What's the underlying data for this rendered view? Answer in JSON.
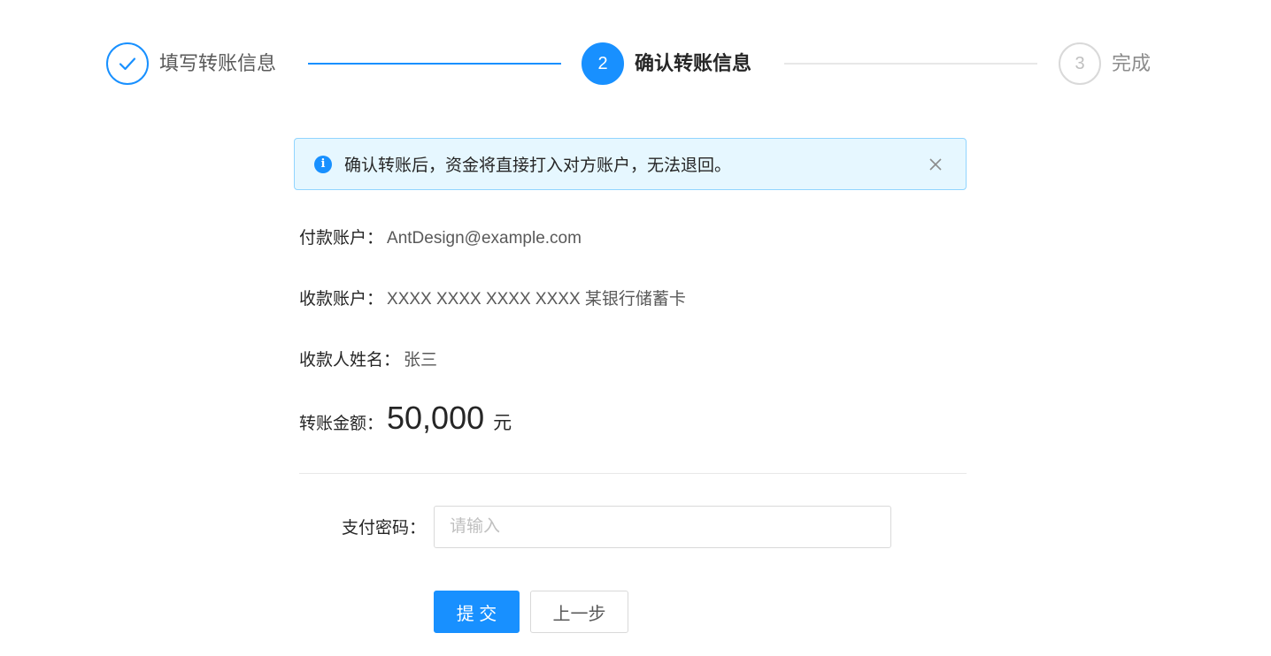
{
  "steps": [
    {
      "label": "填写转账信息",
      "number": ""
    },
    {
      "label": "确认转账信息",
      "number": "2"
    },
    {
      "label": "完成",
      "number": "3"
    }
  ],
  "alert": {
    "message": "确认转账后，资金将直接打入对方账户，无法退回。"
  },
  "details": {
    "payer_label": "付款账户：",
    "payer_value": "AntDesign@example.com",
    "receiver_label": "收款账户：",
    "receiver_value": "XXXX XXXX XXXX XXXX 某银行储蓄卡",
    "name_label": "收款人姓名：",
    "name_value": "张三",
    "amount_label": "转账金额：",
    "amount_value": "50,000",
    "amount_unit": "元"
  },
  "form": {
    "password_label": "支付密码：",
    "password_placeholder": "请输入",
    "submit_label": "提 交",
    "prev_label": "上一步"
  },
  "colors": {
    "primary": "#1890ff",
    "text": "#262626",
    "muted": "#8c8c8c",
    "border": "#d9d9d9",
    "alert_bg": "#e6f7ff",
    "alert_border": "#91d5ff"
  }
}
